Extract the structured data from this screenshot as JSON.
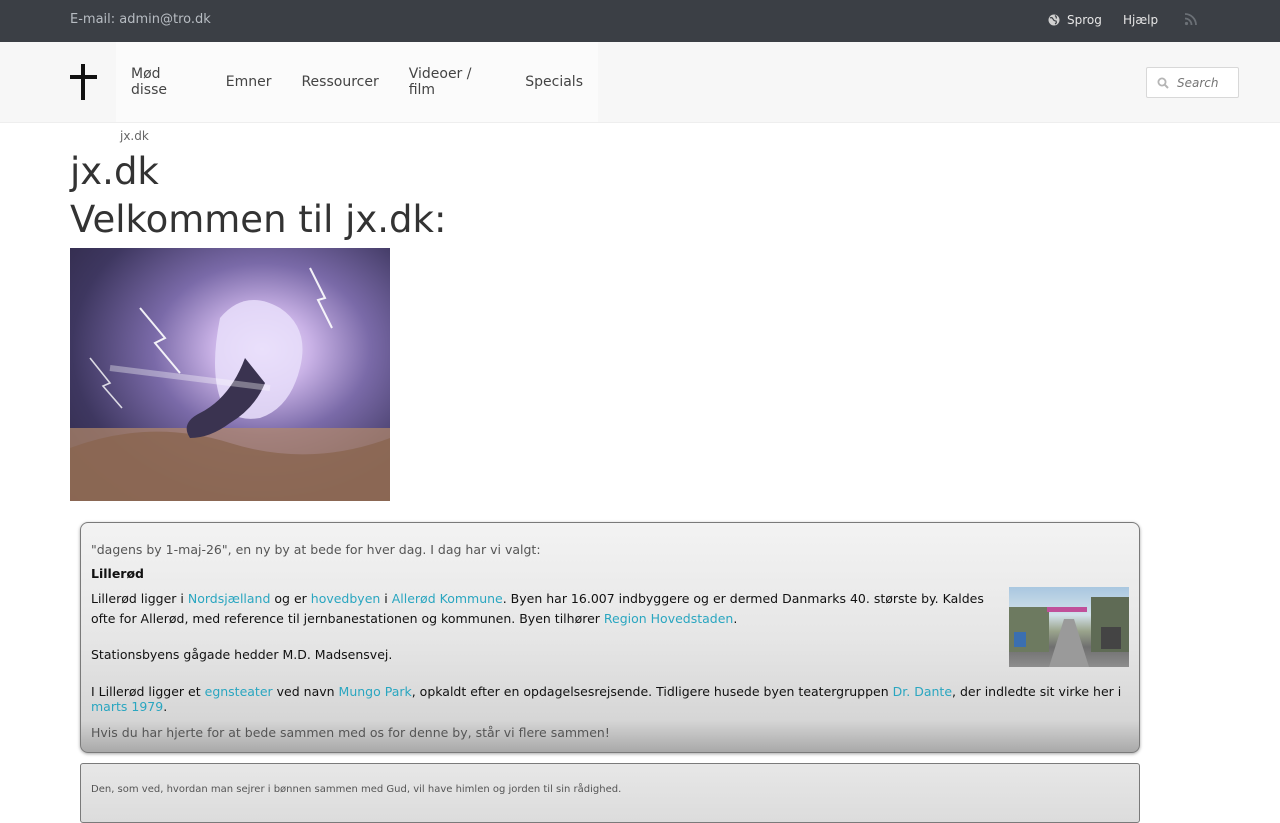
{
  "topbar": {
    "email": "E-mail: admin@tro.dk",
    "language_label": "Sprog",
    "help_label": "Hjælp"
  },
  "nav": {
    "items": [
      "Mød disse",
      "Emner",
      "Ressourcer",
      "Videoer / film",
      "Specials"
    ]
  },
  "search": {
    "placeholder": "Search"
  },
  "breadcrumb": "jx.dk",
  "page": {
    "title": "jx.dk",
    "subtitle": "Velkommen til jx.dk:"
  },
  "city_card": {
    "intro": "\"dagens by 1-maj-26\", en ny by at bede for hver dag. I dag har vi valgt:",
    "city": "Lillerød",
    "p1": {
      "t1": "Lillerød ligger i ",
      "l1": "Nordsjælland",
      "t2": " og er ",
      "l2": "hovedbyen",
      "t3": " i ",
      "l3": "Allerød Kommune",
      "t4": ". Byen har 16.007 indbyggere og er dermed Danmarks 40. største by. Kaldes ofte for Allerød, med reference til jernbanestationen og kommunen. Byen tilhører ",
      "l4": "Region Hovedstaden",
      "t5": "."
    },
    "p2": "Stationsbyens gågade hedder M.D. Madsensvej.",
    "p3": {
      "t1": "I Lillerød ligger et ",
      "l1": "egnsteater",
      "t2": " ved navn ",
      "l2": "Mungo Park",
      "t3": ", opkaldt efter en opdagelsesrejsende. Tidligere husede byen teatergruppen ",
      "l3": "Dr. Dante",
      "t4": ", der indledte sit virke her i ",
      "l4": "marts 1979",
      "t5": "."
    },
    "outro": "Hvis du har hjerte for at bede sammen med os for denne by, står vi flere sammen!"
  },
  "quote_card": {
    "text": "Den, som ved, hvordan man sejrer i bønnen sammen med Gud, vil have himlen og jorden til sin rådighed."
  },
  "icons": {
    "language": "globe-icon",
    "rss": "rss-icon",
    "search": "search-icon",
    "logo": "cross-icon"
  },
  "colors": {
    "topbar_bg": "#3b3f45",
    "link": "#2aa6c0"
  }
}
